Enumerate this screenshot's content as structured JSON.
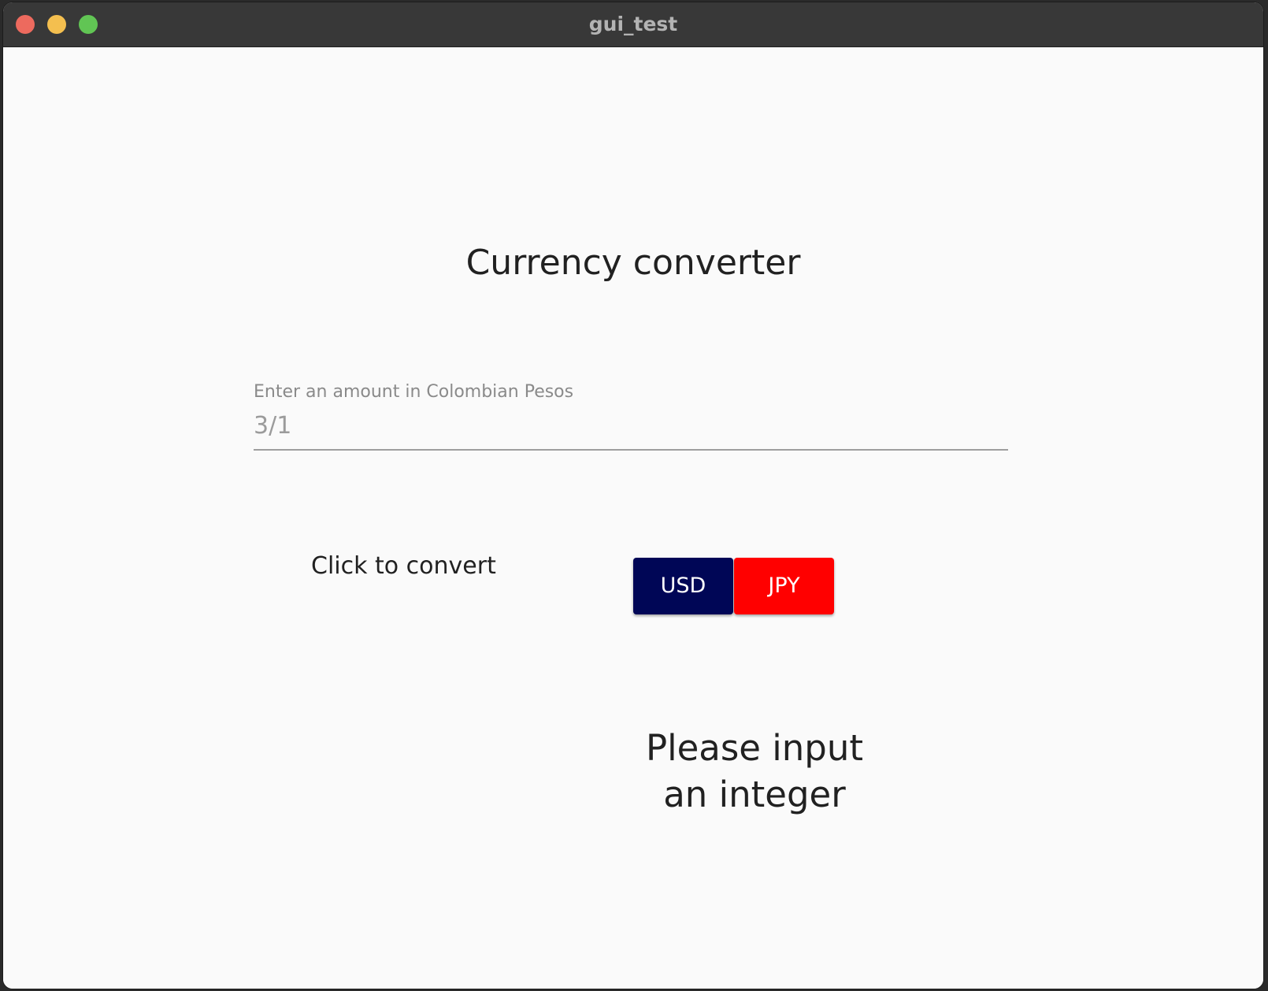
{
  "window": {
    "title": "gui_test"
  },
  "heading": "Currency converter",
  "amount_field": {
    "label": "Enter an amount in Colombian Pesos",
    "value": "3/1"
  },
  "convert": {
    "label": "Click to convert",
    "buttons": [
      {
        "label": "USD",
        "color": "#000656"
      },
      {
        "label": "JPY",
        "color": "#ff0000"
      }
    ]
  },
  "result": {
    "line1": "Please input",
    "line2": "an integer"
  }
}
